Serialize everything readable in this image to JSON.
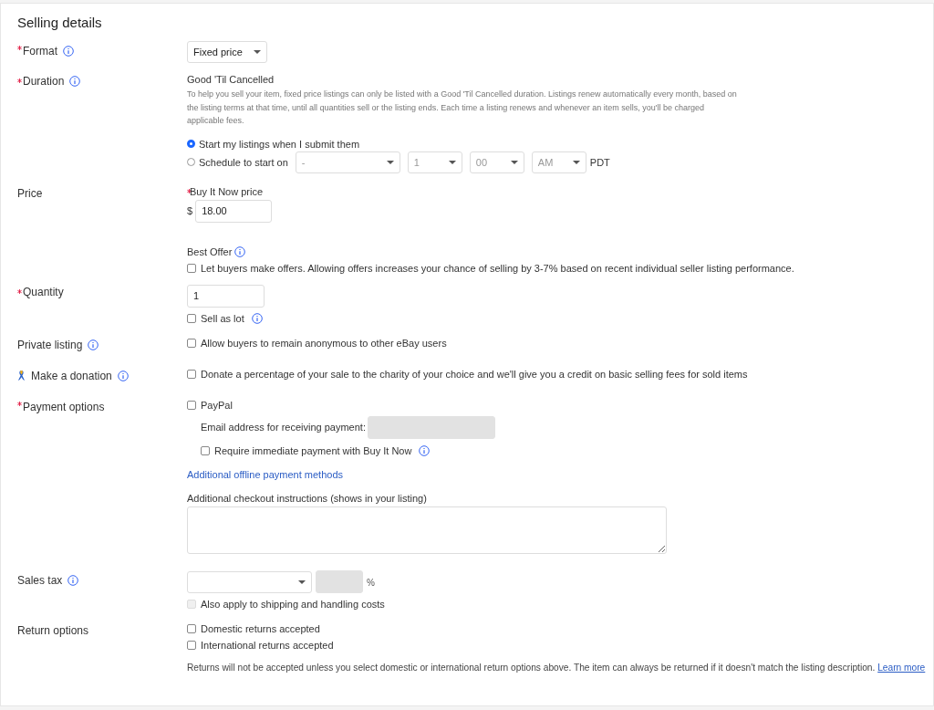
{
  "title": "Selling details",
  "rows": [
    {
      "label": "Format",
      "required": true,
      "info": true,
      "controls": [
        {
          "kind": "select",
          "value": "Fixed price",
          "disabled": false
        }
      ]
    },
    {
      "label": "Duration",
      "required": true,
      "info": true,
      "controls": [
        {
          "kind": "heading",
          "text": "Good 'Til Cancelled"
        },
        {
          "kind": "note",
          "text": "To help you sell your item, fixed price listings can only be listed with a Good 'Til Cancelled duration. Listings renew automatically every month, based on the listing terms at that time, until all quantities sell or the listing ends. Each time a listing renews and whenever an item sells, you'll be charged applicable fees."
        },
        {
          "kind": "radio",
          "label": "Start my listings when I submit them",
          "selected": true
        },
        {
          "kind": "radio",
          "label": "Schedule to start on",
          "selected": false,
          "selects": [
            {
              "value": "-",
              "disabled": true
            },
            {
              "value": "1",
              "disabled": true
            },
            {
              "value": "00",
              "disabled": true
            },
            {
              "value": "AM",
              "disabled": true
            }
          ],
          "suffix": "PDT"
        }
      ]
    },
    {
      "label": "Price",
      "controls": [
        {
          "kind": "field-label",
          "text": "Buy It Now price",
          "required": true
        },
        {
          "kind": "input",
          "prefix": "$",
          "value": "18.00"
        },
        {
          "kind": "heading",
          "text": "Best Offer",
          "info": true
        },
        {
          "kind": "checkbox",
          "label": "Let buyers make offers. Allowing offers increases your chance of selling by 3-7% based on recent individual seller listing performance.",
          "checked": false,
          "disabled": false
        }
      ]
    },
    {
      "label": "Quantity",
      "required": true,
      "controls": [
        {
          "kind": "input",
          "value": "1"
        },
        {
          "kind": "checkbox",
          "label": "Sell as lot",
          "checked": false,
          "disabled": false,
          "info": true
        }
      ]
    },
    {
      "label": "Private listing",
      "info": true,
      "controls": [
        {
          "kind": "checkbox",
          "label": "Allow buyers to remain anonymous to other eBay users",
          "checked": false,
          "disabled": false
        }
      ]
    },
    {
      "label": "Make a donation",
      "info": true,
      "ribbon": true,
      "controls": [
        {
          "kind": "checkbox",
          "label": "Donate a percentage of your sale to the charity of your choice and we'll give you a credit on basic selling fees for sold items",
          "checked": false,
          "disabled": false
        }
      ]
    },
    {
      "label": "Payment options",
      "required": true,
      "controls": [
        {
          "kind": "checkbox",
          "label": "PayPal",
          "checked": false,
          "disabled": false
        },
        {
          "kind": "inline-field",
          "label": "Email address for receiving payment:",
          "disabled": true
        },
        {
          "kind": "checkbox",
          "label": "Require immediate payment with Buy It Now",
          "checked": false,
          "disabled": false,
          "indented": true,
          "info": true
        },
        {
          "kind": "link",
          "text": "Additional offline payment methods"
        },
        {
          "kind": "field-label",
          "text": "Additional checkout instructions (shows in your listing)"
        },
        {
          "kind": "textarea"
        }
      ]
    },
    {
      "label": "Sales tax",
      "info": true,
      "controls": [
        {
          "kind": "tax",
          "unit": "%",
          "percent_disabled": true
        },
        {
          "kind": "checkbox",
          "label": "Also apply to shipping and handling costs",
          "checked": false,
          "disabled": true
        }
      ]
    },
    {
      "label": "Return options",
      "controls": [
        {
          "kind": "checkbox",
          "label": "Domestic returns accepted",
          "checked": false,
          "disabled": false
        },
        {
          "kind": "checkbox",
          "label": "International returns accepted",
          "checked": false,
          "disabled": false
        },
        {
          "kind": "note-link",
          "text": "Returns will not be accepted unless you select domestic or international return options above. The item can always be returned if it doesn't match the listing description.",
          "link": "Learn more"
        }
      ]
    }
  ]
}
